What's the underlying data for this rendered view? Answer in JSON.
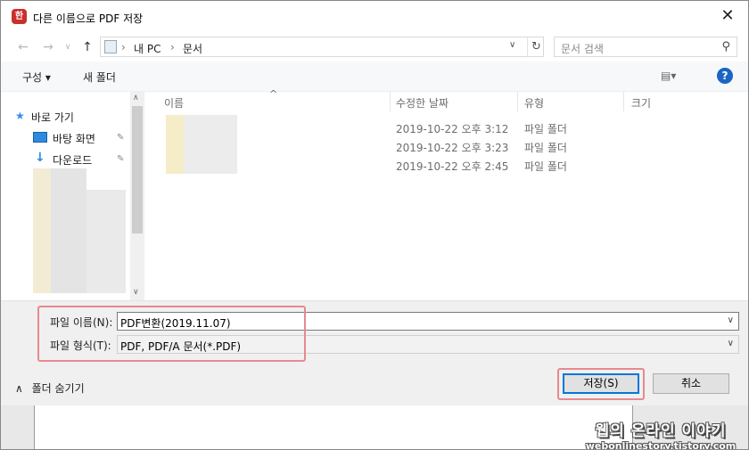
{
  "window": {
    "title": "다른 이름으로 PDF 저장",
    "app_icon_glyph": "한",
    "close_glyph": "✕"
  },
  "nav": {
    "back_glyph": "←",
    "forward_glyph": "→",
    "dropdown_glyph": "∨",
    "up_glyph": "↑",
    "breadcrumb": [
      "내 PC",
      "문서"
    ],
    "separator": "›",
    "refresh_glyph": "↻",
    "search_placeholder": "문서 검색",
    "search_glyph": "⚲"
  },
  "toolbar": {
    "organize": "구성 ▾",
    "new_folder": "새 폴더",
    "view_glyph": "▤▾",
    "help_glyph": "?"
  },
  "navpane": {
    "items": [
      {
        "label": "바로 가기",
        "icon": "star-icon"
      },
      {
        "label": "바탕 화면",
        "icon": "desktop-icon",
        "pinned": true
      },
      {
        "label": "다운로드",
        "icon": "download-icon",
        "pinned": true
      }
    ],
    "pin_glyph": "✎",
    "scroll_up": "∧",
    "scroll_down": "∨"
  },
  "list": {
    "sort_glyph": "^",
    "columns": [
      "이름",
      "수정한 날짜",
      "유형",
      "크기"
    ],
    "rows": [
      {
        "date": "2019-10-22 오후 3:12",
        "type": "파일 폴더"
      },
      {
        "date": "2019-10-22 오후 3:23",
        "type": "파일 폴더"
      },
      {
        "date": "2019-10-22 오후 2:45",
        "type": "파일 폴더"
      }
    ]
  },
  "save": {
    "filename_label": "파일 이름(N):",
    "filename_value": "PDF변환(2019.11.07)",
    "filetype_label": "파일 형식(T):",
    "filetype_value": "PDF, PDF/A 문서(*.PDF)",
    "dd_glyph": "∨",
    "hide_folders": "폴더 숨기기",
    "hide_glyph": "∧",
    "save_button": "저장(S)",
    "cancel_button": "취소"
  },
  "watermark": {
    "line1": "웹의 온라인 이야기",
    "line2": "webonlinestory.tistory.com"
  },
  "colors": {
    "accent": "#0078d7",
    "highlight": "#e58a8f",
    "help": "#1a66c2"
  }
}
